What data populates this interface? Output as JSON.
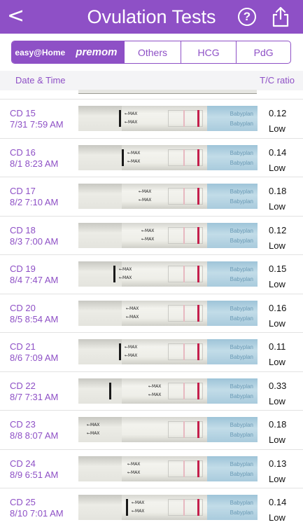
{
  "header": {
    "back_glyph": "<",
    "title": "Ovulation Tests",
    "help_glyph": "?",
    "share_icon": "share-icon",
    "color": "#8e50c6"
  },
  "tabs": [
    {
      "label": "easy@Home",
      "selected": true
    },
    {
      "label": "premom",
      "selected": true
    },
    {
      "label": "Others",
      "selected": false
    },
    {
      "label": "HCG",
      "selected": false
    },
    {
      "label": "PdG",
      "selected": false
    }
  ],
  "columns": {
    "date": "Date & Time",
    "ratio": "T/C ratio"
  },
  "rows": [
    {
      "cd": "CD 15",
      "datetime": "7/31 7:59 AM",
      "ratio": "0.12",
      "level": "Low"
    },
    {
      "cd": "CD 16",
      "datetime": "8/1 8:23 AM",
      "ratio": "0.14",
      "level": "Low"
    },
    {
      "cd": "CD 17",
      "datetime": "8/2 7:10 AM",
      "ratio": "0.18",
      "level": "Low"
    },
    {
      "cd": "CD 18",
      "datetime": "8/3 7:00 AM",
      "ratio": "0.12",
      "level": "Low"
    },
    {
      "cd": "CD 19",
      "datetime": "8/4 7:47 AM",
      "ratio": "0.15",
      "level": "Low"
    },
    {
      "cd": "CD 20",
      "datetime": "8/5 8:54 AM",
      "ratio": "0.16",
      "level": "Low"
    },
    {
      "cd": "CD 21",
      "datetime": "8/6 7:09 AM",
      "ratio": "0.11",
      "level": "Low"
    },
    {
      "cd": "CD 22",
      "datetime": "8/7 7:31 AM",
      "ratio": "0.33",
      "level": "Low"
    },
    {
      "cd": "CD 23",
      "datetime": "8/8 8:07 AM",
      "ratio": "0.18",
      "level": "Low"
    },
    {
      "cd": "CD 24",
      "datetime": "8/9 6:51 AM",
      "ratio": "0.13",
      "level": "Low"
    },
    {
      "cd": "CD 25",
      "datetime": "8/10 7:01 AM",
      "ratio": "0.14",
      "level": "Low"
    }
  ],
  "strip_text": {
    "max": "←MAX",
    "brand": "Babyplan"
  }
}
